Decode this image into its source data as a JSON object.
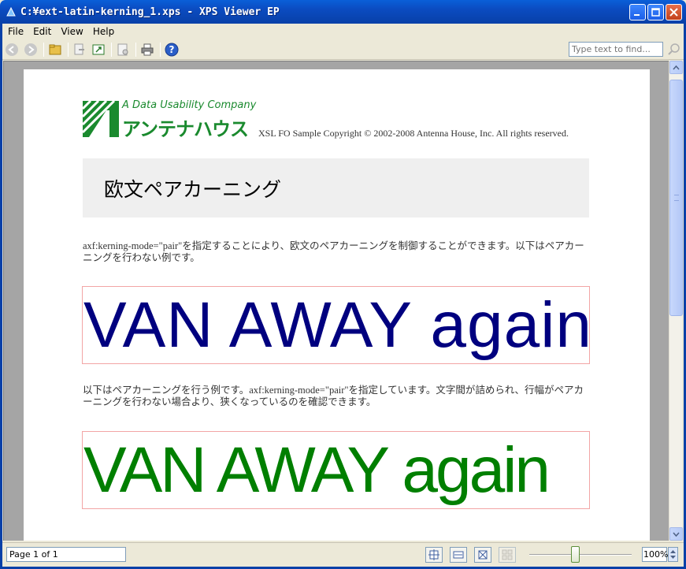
{
  "window": {
    "title": "C:¥ext-latin-kerning_1.xps - XPS Viewer EP"
  },
  "menu": {
    "file": "File",
    "edit": "Edit",
    "view": "View",
    "help": "Help"
  },
  "toolbar": {
    "find_placeholder": "Type text to find..."
  },
  "page": {
    "logo_tagline": "A Data Usability Company",
    "logo_name": "アンテナハウス",
    "copyright": "XSL FO Sample Copyright © 2002-2008 Antenna House, Inc. All rights reserved.",
    "heading": "欧文ペアカーニング",
    "paragraph1": "axf:kerning-mode=\"pair\"を指定することにより、欧文のペアカーニングを制御することができます。以下はペアカーニングを行わない例です。",
    "sample1": "VAN AWAY again",
    "paragraph2": "以下はペアカーニングを行う例です。axf:kerning-mode=\"pair\"を指定しています。文字間が詰められ、行幅がペアカーニングを行わない場合より、狭くなっているのを確認できます。",
    "sample2": "VAN AWAY again"
  },
  "status": {
    "page_indicator": "Page 1 of 1",
    "zoom": "100%",
    "zoom_level_percent": 100
  },
  "colors": {
    "titlebar": "#0b4bc0",
    "sample_no_kerning": "#00007f",
    "sample_kerning": "#007f00",
    "sample_border": "#f2a5a5",
    "logo_green": "#1a8a2e"
  }
}
